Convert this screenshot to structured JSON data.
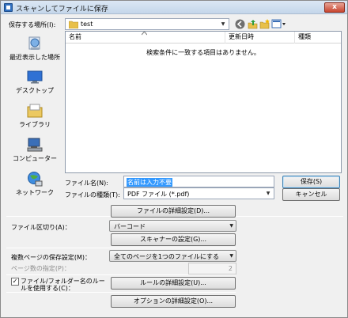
{
  "window": {
    "title": "スキャンしてファイルに保存",
    "close_glyph": "x"
  },
  "save_location": {
    "label": "保存する場所(I):",
    "value": "test"
  },
  "places": [
    {
      "label": "最近表示した場所",
      "icon": "recent-places-icon"
    },
    {
      "label": "デスクトップ",
      "icon": "desktop-icon"
    },
    {
      "label": "ライブラリ",
      "icon": "library-icon"
    },
    {
      "label": "コンピューター",
      "icon": "computer-icon"
    },
    {
      "label": "ネットワーク",
      "icon": "network-icon"
    }
  ],
  "file_list": {
    "columns": [
      "名前",
      "更新日時",
      "種類"
    ],
    "empty_message": "検索条件に一致する項目はありません。"
  },
  "filename": {
    "label": "ファイル名(N):",
    "value": "名前は入力不要"
  },
  "filetype": {
    "label": "ファイルの種類(T):",
    "value": "PDF ファイル (*.pdf)"
  },
  "buttons": {
    "save": "保存(S)",
    "cancel": "キャンセル",
    "file_detail": "ファイルの詳細設定(D)...",
    "scanner_settings": "スキャナーの設定(G)...",
    "rule_detail": "ルールの詳細設定(U)...",
    "option_detail": "オプションの詳細設定(O)..."
  },
  "file_split": {
    "label": "ファイル区切り(A)：",
    "value": "バーコード"
  },
  "multipage": {
    "label": "複数ページの保存設定(M)：",
    "value": "全てのページを1つのファイルにする",
    "page_count_label": "ページ数の指定(P)：",
    "page_count_value": "2"
  },
  "folder_rule": {
    "label": "ファイル/フォルダー名のルールを使用する(C)：",
    "checked": true,
    "check_glyph": "✓"
  },
  "colors": {
    "accent": "#3399ff",
    "selection": "#3399ff"
  }
}
